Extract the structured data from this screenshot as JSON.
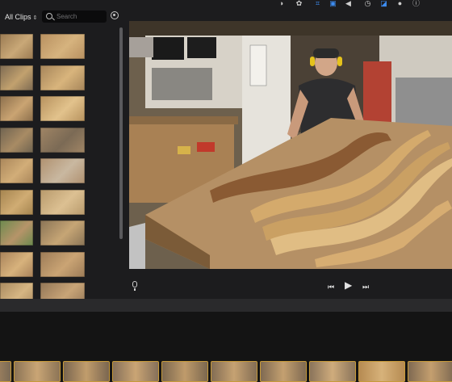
{
  "browser": {
    "filter_label": "All Clips",
    "search_placeholder": "Search"
  },
  "toolbar": {
    "tools": [
      {
        "name": "color-balance-icon",
        "glyph": "◑"
      },
      {
        "name": "color-correction-icon",
        "glyph": "✿"
      },
      {
        "name": "crop-icon",
        "glyph": "⌗"
      },
      {
        "name": "stabilization-icon",
        "glyph": "▣"
      },
      {
        "name": "volume-icon",
        "glyph": "◀"
      },
      {
        "name": "speed-icon",
        "glyph": "◷"
      },
      {
        "name": "noise-reduction-icon",
        "glyph": "◪"
      },
      {
        "name": "clip-filter-icon",
        "glyph": "●"
      },
      {
        "name": "info-icon",
        "glyph": "ⓘ"
      }
    ]
  },
  "playback": {
    "prev_glyph": "⏮",
    "play_glyph": "▶",
    "next_glyph": "⏭"
  },
  "clips": [
    {
      "c1": "#9a7a52",
      "c2": "#c9a877"
    },
    {
      "c1": "#b89060",
      "c2": "#d6b37e"
    },
    {
      "c1": "#7d6a52",
      "c2": "#c2a16e"
    },
    {
      "c1": "#a6855a",
      "c2": "#d8b47c"
    },
    {
      "c1": "#8c6f4c",
      "c2": "#caa472"
    },
    {
      "c1": "#b7925e",
      "c2": "#e2c28c"
    },
    {
      "c1": "#6f6350",
      "c2": "#a88b64"
    },
    {
      "c1": "#a08565",
      "c2": "#7b6a55"
    },
    {
      "c1": "#a9865a",
      "c2": "#d2ad78"
    },
    {
      "c1": "#b09170",
      "c2": "#c9b8a0"
    },
    {
      "c1": "#a4844f",
      "c2": "#d0ac73"
    },
    {
      "c1": "#b89a6c",
      "c2": "#dcc092"
    },
    {
      "c1": "#6c8a4e",
      "c2": "#b69469"
    },
    {
      "c1": "#8a7456",
      "c2": "#c6a575"
    },
    {
      "c1": "#a8825a",
      "c2": "#d7b27c"
    },
    {
      "c1": "#9c7b57",
      "c2": "#caa474"
    },
    {
      "c1": "#a98a60",
      "c2": "#d6b683"
    },
    {
      "c1": "#937657",
      "c2": "#c8a477"
    }
  ],
  "timeline_clips": [
    {
      "c1": "#7b6a55",
      "c2": "#b59165"
    },
    {
      "c1": "#8c7456",
      "c2": "#c9a575"
    },
    {
      "c1": "#7a6650",
      "c2": "#c19d6c"
    },
    {
      "c1": "#86705a",
      "c2": "#caa574"
    },
    {
      "c1": "#7c684f",
      "c2": "#bf9b6b"
    },
    {
      "c1": "#836d54",
      "c2": "#c6a272"
    },
    {
      "c1": "#7f6a52",
      "c2": "#c4a070"
    },
    {
      "c1": "#8a745b",
      "c2": "#cfac7c"
    },
    {
      "c1": "#b68b52",
      "c2": "#d7b27a"
    },
    {
      "c1": "#7f6a52",
      "c2": "#c49f6f"
    }
  ]
}
